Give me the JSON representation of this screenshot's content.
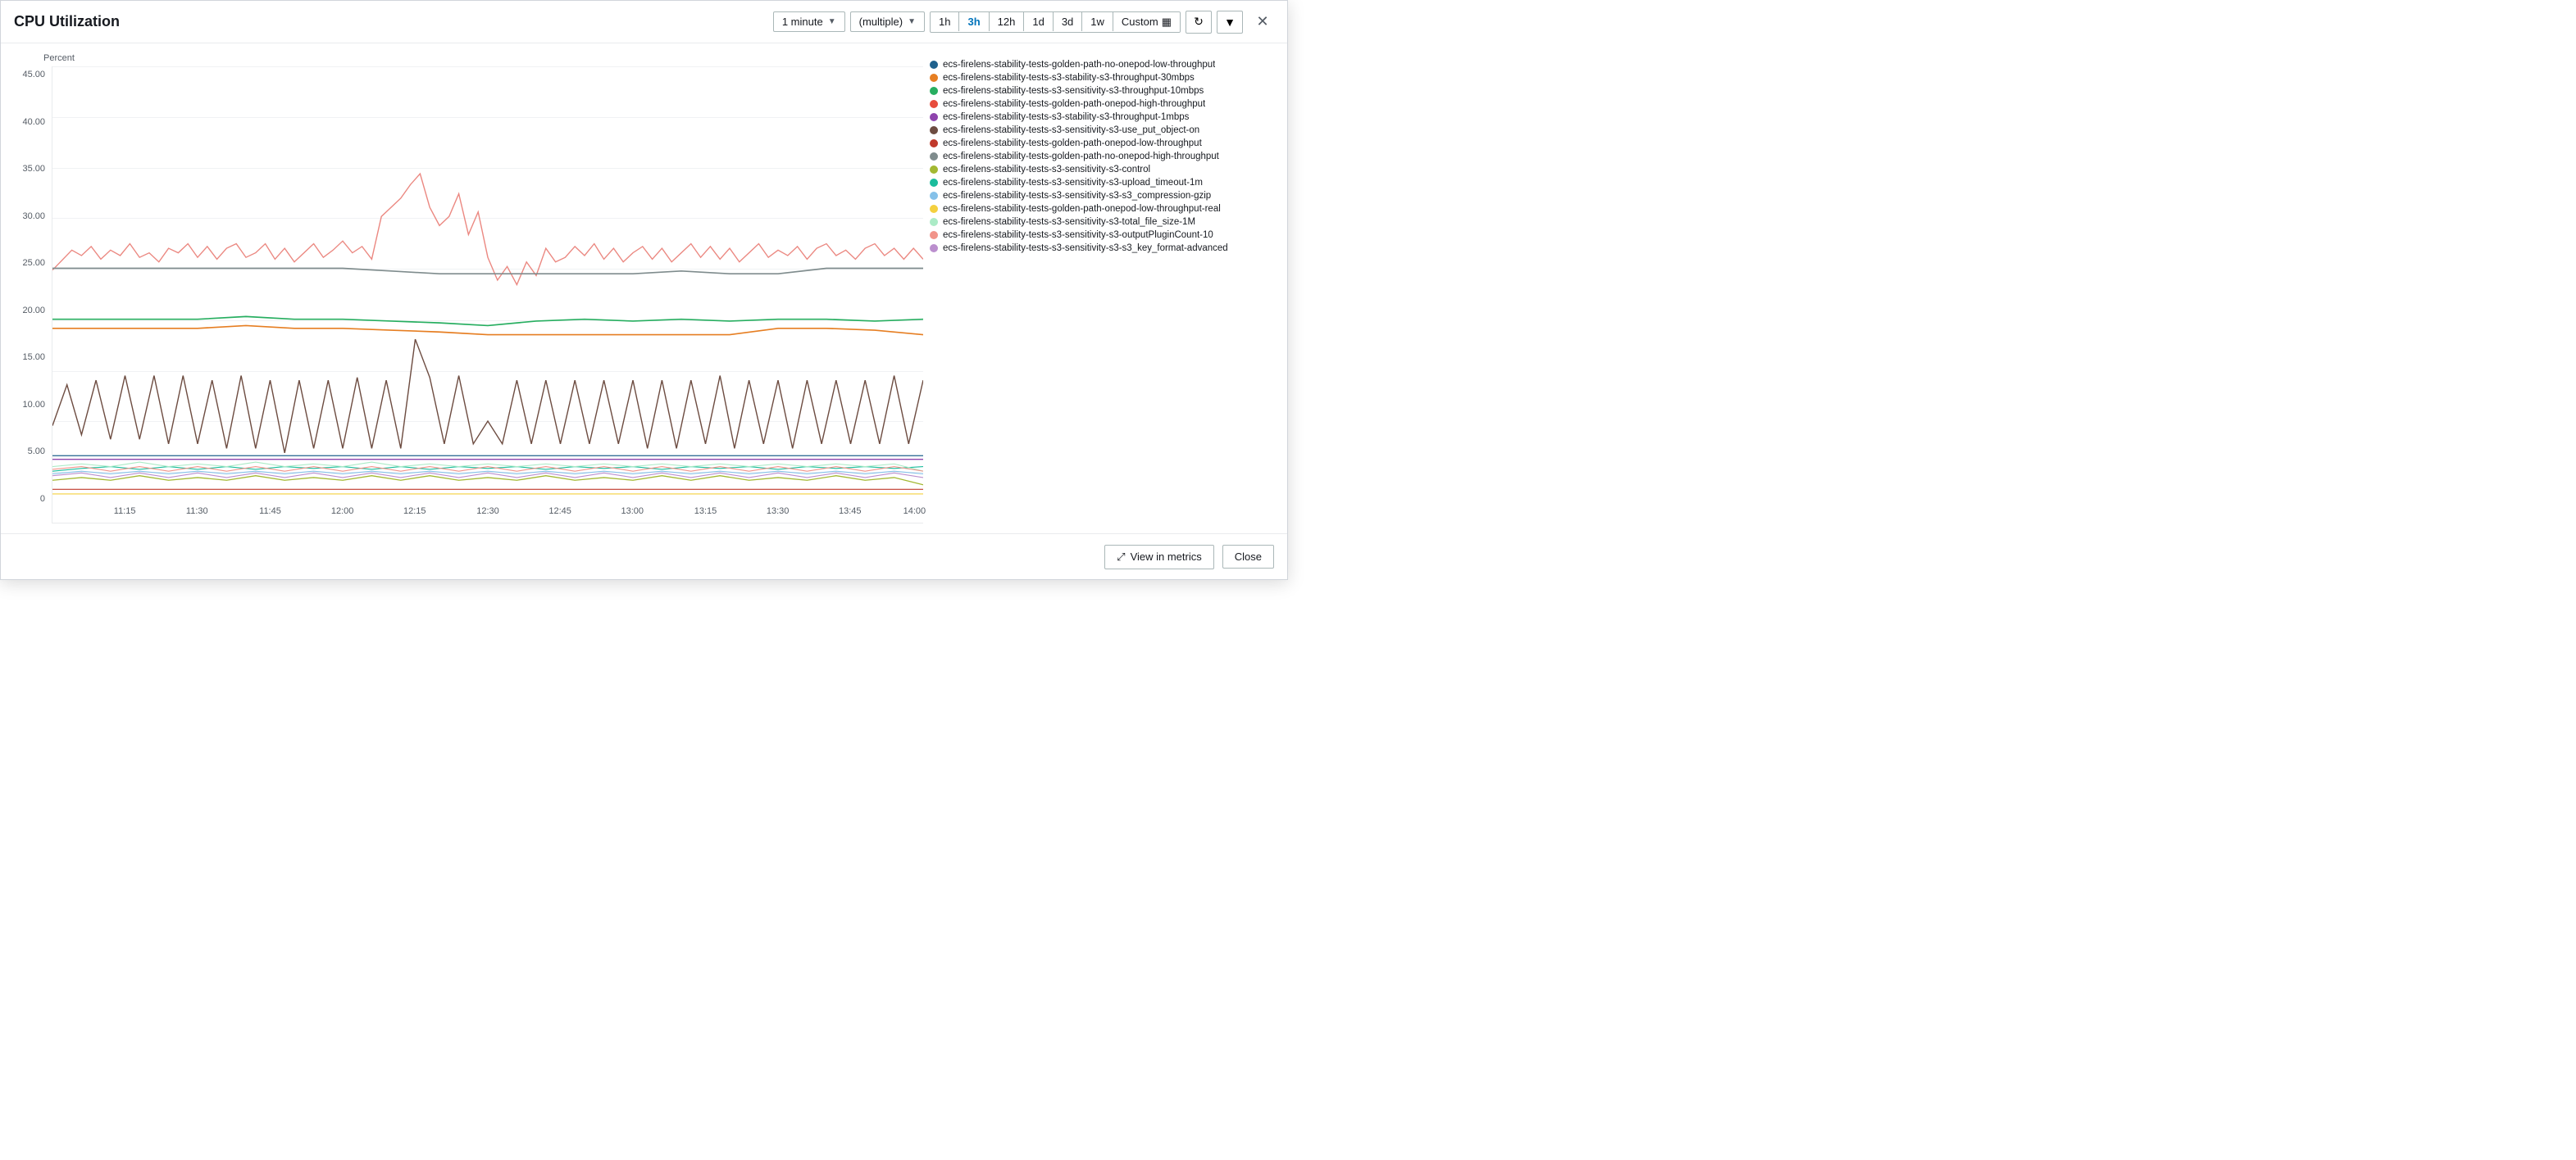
{
  "header": {
    "title": "CPU Utilization",
    "interval_label": "1 minute",
    "stat_label": "(multiple)",
    "time_options": [
      "1h",
      "3h",
      "12h",
      "1d",
      "3d",
      "1w"
    ],
    "active_time": "3h",
    "custom_label": "Custom",
    "refresh_icon": "↻",
    "dropdown_icon": "▼",
    "close_icon": "✕"
  },
  "chart": {
    "y_axis_label": "Percent",
    "y_ticks": [
      "45.00",
      "40.00",
      "35.00",
      "30.00",
      "25.00",
      "20.00",
      "15.00",
      "10.00",
      "5.00",
      "0"
    ],
    "x_ticks": [
      "11:15",
      "11:30",
      "11:45",
      "12:00",
      "12:15",
      "12:30",
      "12:45",
      "13:00",
      "13:15",
      "13:30",
      "13:45",
      "14:00"
    ]
  },
  "legend": {
    "items": [
      {
        "color": "#1f618d",
        "label": "ecs-firelens-stability-tests-golden-path-no-onepod-low-throughput"
      },
      {
        "color": "#e67e22",
        "label": "ecs-firelens-stability-tests-s3-stability-s3-throughput-30mbps"
      },
      {
        "color": "#27ae60",
        "label": "ecs-firelens-stability-tests-s3-sensitivity-s3-throughput-10mbps"
      },
      {
        "color": "#e74c3c",
        "label": "ecs-firelens-stability-tests-golden-path-onepod-high-throughput"
      },
      {
        "color": "#8e44ad",
        "label": "ecs-firelens-stability-tests-s3-stability-s3-throughput-1mbps"
      },
      {
        "color": "#5d4037",
        "label": "ecs-firelens-stability-tests-s3-sensitivity-s3-use_put_object-on"
      },
      {
        "color": "#c0392b",
        "label": "ecs-firelens-stability-tests-golden-path-onepod-low-throughput"
      },
      {
        "color": "#7f8c8d",
        "label": "ecs-firelens-stability-tests-golden-path-no-onepod-high-throughput"
      },
      {
        "color": "#a3b832",
        "label": "ecs-firelens-stability-tests-s3-sensitivity-s3-control"
      },
      {
        "color": "#1abc9c",
        "label": "ecs-firelens-stability-tests-s3-sensitivity-s3-upload_timeout-1m"
      },
      {
        "color": "#85c1e9",
        "label": "ecs-firelens-stability-tests-s3-sensitivity-s3-s3_compression-gzip"
      },
      {
        "color": "#f4d03f",
        "label": "ecs-firelens-stability-tests-golden-path-onepod-low-throughput-real"
      },
      {
        "color": "#abebc6",
        "label": "ecs-firelens-stability-tests-s3-sensitivity-s3-total_file_size-1M"
      },
      {
        "color": "#f1948a",
        "label": "ecs-firelens-stability-tests-s3-sensitivity-s3-outputPluginCount-10"
      },
      {
        "color": "#bb8fce",
        "label": "ecs-firelens-stability-tests-s3-sensitivity-s3-s3_key_format-advanced"
      }
    ]
  },
  "footer": {
    "view_metrics_label": "View in metrics",
    "close_label": "Close",
    "external_link_icon": "⤢"
  }
}
